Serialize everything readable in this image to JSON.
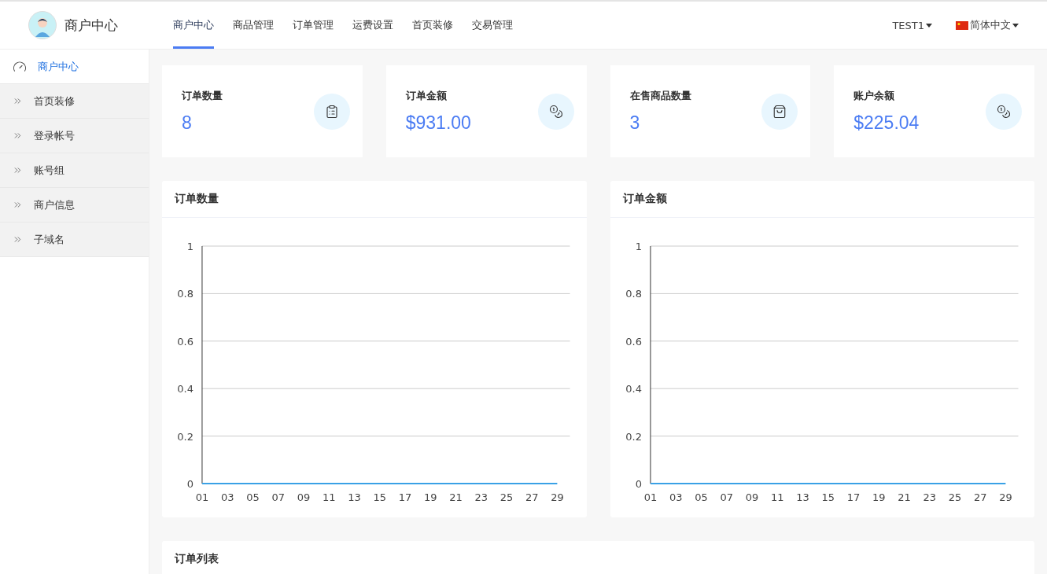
{
  "header": {
    "brand": "商户中心",
    "nav": [
      {
        "label": "商户中心",
        "selected": true
      },
      {
        "label": "商品管理",
        "selected": false
      },
      {
        "label": "订单管理",
        "selected": false
      },
      {
        "label": "运费设置",
        "selected": false
      },
      {
        "label": "首页装修",
        "selected": false
      },
      {
        "label": "交易管理",
        "selected": false
      }
    ],
    "user": "TEST1",
    "language": "简体中文"
  },
  "sidebar": {
    "items": [
      {
        "label": "商户中心",
        "kind": "dashboard",
        "selected": true
      },
      {
        "label": "首页装修",
        "kind": "link",
        "selected": false
      },
      {
        "label": "登录帐号",
        "kind": "link",
        "selected": false
      },
      {
        "label": "账号组",
        "kind": "link",
        "selected": false
      },
      {
        "label": "商户信息",
        "kind": "link",
        "selected": false
      },
      {
        "label": "子域名",
        "kind": "link",
        "selected": false
      }
    ]
  },
  "stats": [
    {
      "title": "订单数量",
      "value": "8",
      "kind": "orders"
    },
    {
      "title": "订单金额",
      "value": "$931.00",
      "kind": "money"
    },
    {
      "title": "在售商品数量",
      "value": "3",
      "kind": "products"
    },
    {
      "title": "账户余额",
      "value": "$225.04",
      "kind": "money"
    }
  ],
  "charts": [
    {
      "title": "订单数量",
      "chart_data": {
        "type": "line",
        "categories": [
          "01",
          "03",
          "05",
          "07",
          "09",
          "11",
          "13",
          "15",
          "17",
          "19",
          "21",
          "23",
          "25",
          "27",
          "29"
        ],
        "series": [
          {
            "color": "#3aa1e6",
            "values": [
              0,
              0,
              0,
              0,
              0,
              0,
              0,
              0,
              0,
              0,
              0,
              0,
              0,
              0,
              0
            ]
          }
        ],
        "ylim": [
          0,
          1
        ],
        "yticks": [
          0,
          0.2,
          0.4,
          0.6,
          0.8,
          1
        ],
        "grid": true
      }
    },
    {
      "title": "订单金额",
      "chart_data": {
        "type": "line",
        "categories": [
          "01",
          "03",
          "05",
          "07",
          "09",
          "11",
          "13",
          "15",
          "17",
          "19",
          "21",
          "23",
          "25",
          "27",
          "29"
        ],
        "series": [
          {
            "color": "#3aa1e6",
            "values": [
              0,
              0,
              0,
              0,
              0,
              0,
              0,
              0,
              0,
              0,
              0,
              0,
              0,
              0,
              0
            ]
          }
        ],
        "ylim": [
          0,
          1
        ],
        "yticks": [
          0,
          0.2,
          0.4,
          0.6,
          0.8,
          1
        ],
        "grid": true
      }
    }
  ],
  "order_list": {
    "title": "订单列表"
  }
}
